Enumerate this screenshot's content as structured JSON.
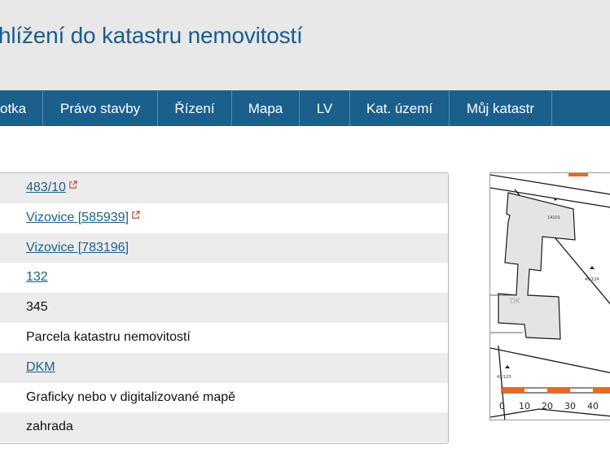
{
  "header": {
    "title": "hlížení do katastru nemovitostí"
  },
  "nav": {
    "items": [
      {
        "label": "otka"
      },
      {
        "label": "Právo stavby"
      },
      {
        "label": "Řízení"
      },
      {
        "label": "Mapa"
      },
      {
        "label": "LV"
      },
      {
        "label": "Kat. území"
      },
      {
        "label": "Můj katastr"
      }
    ]
  },
  "details": {
    "rows": [
      {
        "value": "483/10",
        "link": true,
        "external": true
      },
      {
        "value": "Vizovice [585939]",
        "link": true,
        "external": true
      },
      {
        "value": "Vizovice [783196]",
        "link": true,
        "external": false
      },
      {
        "value": "132",
        "link": true,
        "external": false
      },
      {
        "value": "345",
        "link": false,
        "external": false
      },
      {
        "value": "Parcela katastru nemovitostí",
        "link": false,
        "external": false
      },
      {
        "value": "DKM",
        "link": true,
        "external": false
      },
      {
        "value": "Graficky nebo v digitalizované mapě",
        "link": false,
        "external": false
      },
      {
        "value": "zahrada",
        "link": false,
        "external": false
      }
    ]
  },
  "map": {
    "labels": {
      "building": "14101",
      "parcel_mid": "49/124",
      "parcel_left": "43/123",
      "parcel_small": "DK"
    },
    "scale_ticks": [
      "0",
      "10",
      "20",
      "30",
      "40"
    ],
    "colors": {
      "scale_orange": "#e8691f",
      "line": "#1a1a1a",
      "building_fill": "#e4e4e4"
    }
  },
  "colors": {
    "nav_bg": "#1b5f8c",
    "header_bg": "#e8e8e8",
    "title": "#1a5c8a",
    "link": "#1b5f8c",
    "external_icon": "#c0392b"
  }
}
